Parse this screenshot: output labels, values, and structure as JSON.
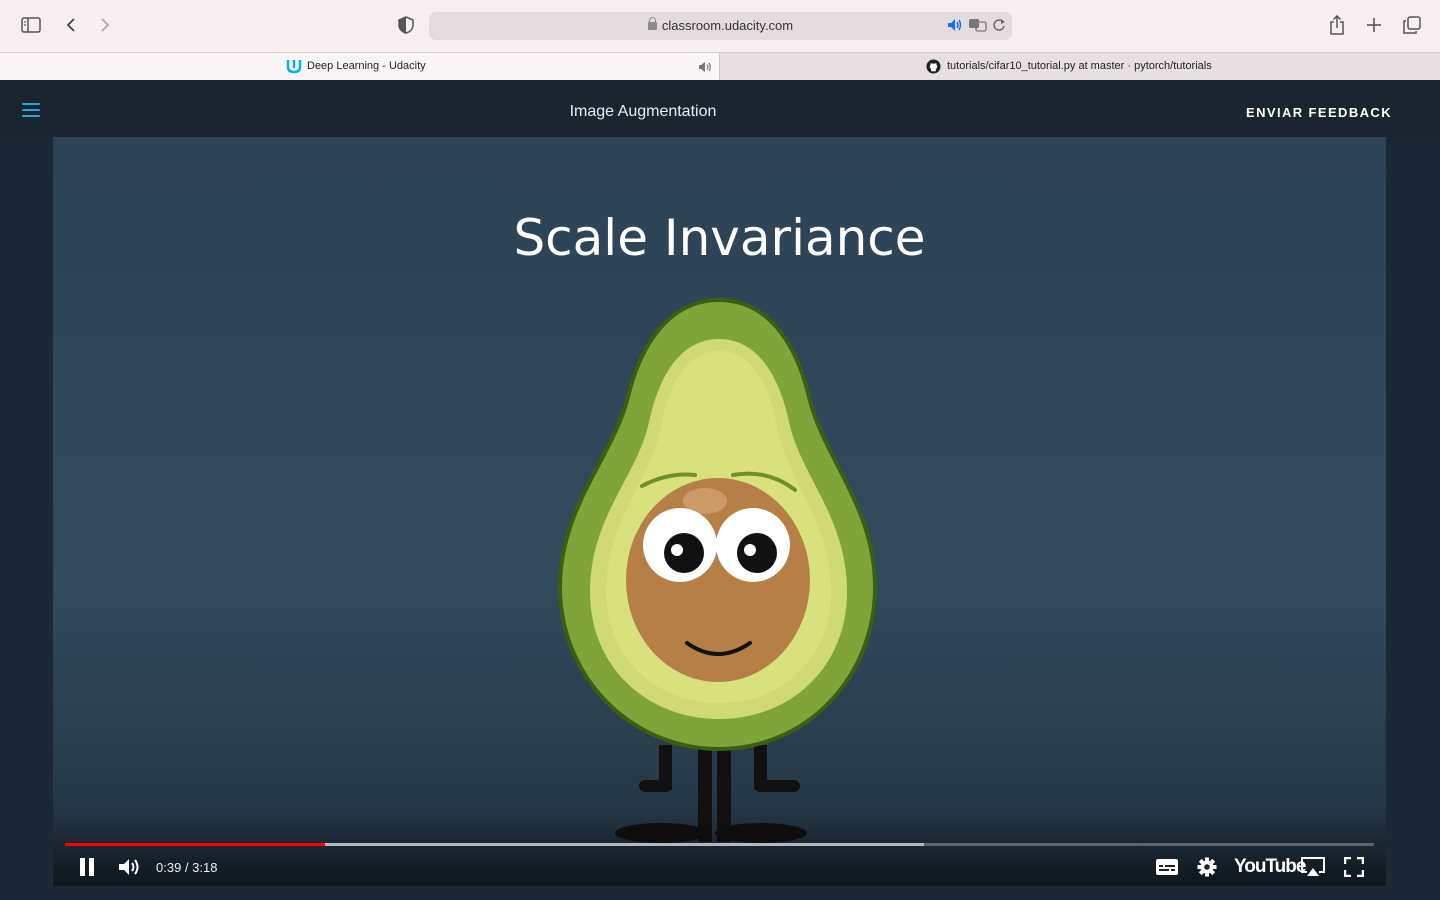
{
  "browser": {
    "url": "classroom.udacity.com",
    "tabs": [
      {
        "label": "Deep Learning - Udacity",
        "active": true
      },
      {
        "label": "tutorials/cifar10_tutorial.py at master · pytorch/tutorials",
        "active": false
      }
    ]
  },
  "header": {
    "title": "Image Augmentation",
    "feedback_label": "ENVIAR FEEDBACK"
  },
  "video": {
    "slide_title": "Scale Invariance",
    "time_display": "0:39 / 3:18",
    "played_fraction": 0.199,
    "buffered_fraction": 0.656,
    "youtube_label": "YouTube"
  },
  "colors": {
    "accent": "#2aa6dc",
    "progress": "#ff0000",
    "header_bg": "#1b2530"
  }
}
